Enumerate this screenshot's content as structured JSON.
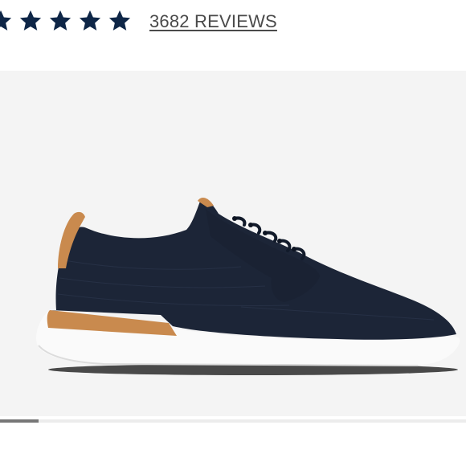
{
  "rating": {
    "star_count": 5,
    "stars_filled": 5,
    "star_icon": "star-icon",
    "star_color": "#0e2647",
    "reviews_label": "3682 REVIEWS",
    "reviews_color": "#4a4a4a"
  },
  "gallery": {
    "background": "#f4f4f4",
    "image": "navy-knit-sneaker",
    "current_position": 0.08
  },
  "colors": {
    "shoe_upper": "#1c2537",
    "heel_accent": "#c98a4e",
    "sole": "#fafafa"
  }
}
